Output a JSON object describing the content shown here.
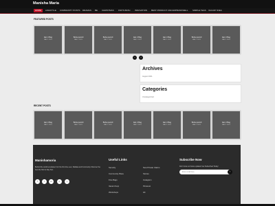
{
  "site": {
    "name": "Manisha Maria"
  },
  "nav": {
    "items": [
      "HOME",
      "LIFESTYLE",
      "COMMUNITY POSTS",
      "DRAMAS",
      "BE",
      "CHRISTMAS",
      "KNITS BATH",
      "INNOVATION",
      "BEST PRODUCT 2021/22",
      "PRANKWELL",
      "SIMPLE TEAS",
      "VACANT IDEA"
    ]
  },
  "featured": {
    "title": "FEATURED POSTS",
    "cards": [
      {
        "title": "Eat ci Bag",
        "date": "MAY 1 2021"
      },
      {
        "title": "Beba quondi",
        "date": "MAY 1 2021"
      },
      {
        "title": "Beba quondi",
        "date": "MAY 1 2021"
      },
      {
        "title": "Eat ci Bag",
        "date": "MAY 1 2021"
      },
      {
        "title": "Eat ci Bag",
        "date": "MAY 1 2021"
      },
      {
        "title": "Beba quondi",
        "date": "MAY 1 2021"
      },
      {
        "title": "Eat ci Bag",
        "date": "MAY 1 2021"
      }
    ],
    "prev_icon": "‹",
    "next_icon": "›"
  },
  "archives": {
    "title": "Archives",
    "text": "August 2021"
  },
  "categories": {
    "title": "Categories",
    "text": "Uncategorized"
  },
  "recent": {
    "title": "RECENT POSTS",
    "cards": [
      {
        "title": "Eat ci Bag",
        "date": "MAY 1 2021"
      },
      {
        "title": "Beba quondi",
        "date": "MAY 1 2021"
      },
      {
        "title": "Beba quondi",
        "date": "MAY 1 2021"
      },
      {
        "title": "Eat ci Bag",
        "date": "MAY 1 2021"
      },
      {
        "title": "Eat ci Bag",
        "date": "MAY 1 2021"
      },
      {
        "title": "Beba quondi",
        "date": "MAY 1 2021"
      },
      {
        "title": "Eat ci Bag",
        "date": "MAY 1 2021"
      }
    ]
  },
  "footer": {
    "brand": "Manishamoria",
    "description": "Behold the world remodeled. For the first time ever, Rabaka and Community. Discover the best the first its Day Test.",
    "social": [
      "f",
      "t",
      "in",
      "p",
      "y"
    ],
    "useful_links_title": "Useful Links",
    "links_col1": [
      "Security",
      "Community Place",
      "Fine Bags",
      "Vacant Kerp",
      "Workshops"
    ],
    "links_col2": [
      "New Private Claims",
      "Stories",
      "Instagram",
      "Pinterest",
      "Hit"
    ],
    "subscribe_title": "Subscribe Now",
    "subscribe_text": "Don't miss our future updates! Get Subscribed Today!",
    "email_placeholder": "Enter email here",
    "submit_icon": "›"
  }
}
